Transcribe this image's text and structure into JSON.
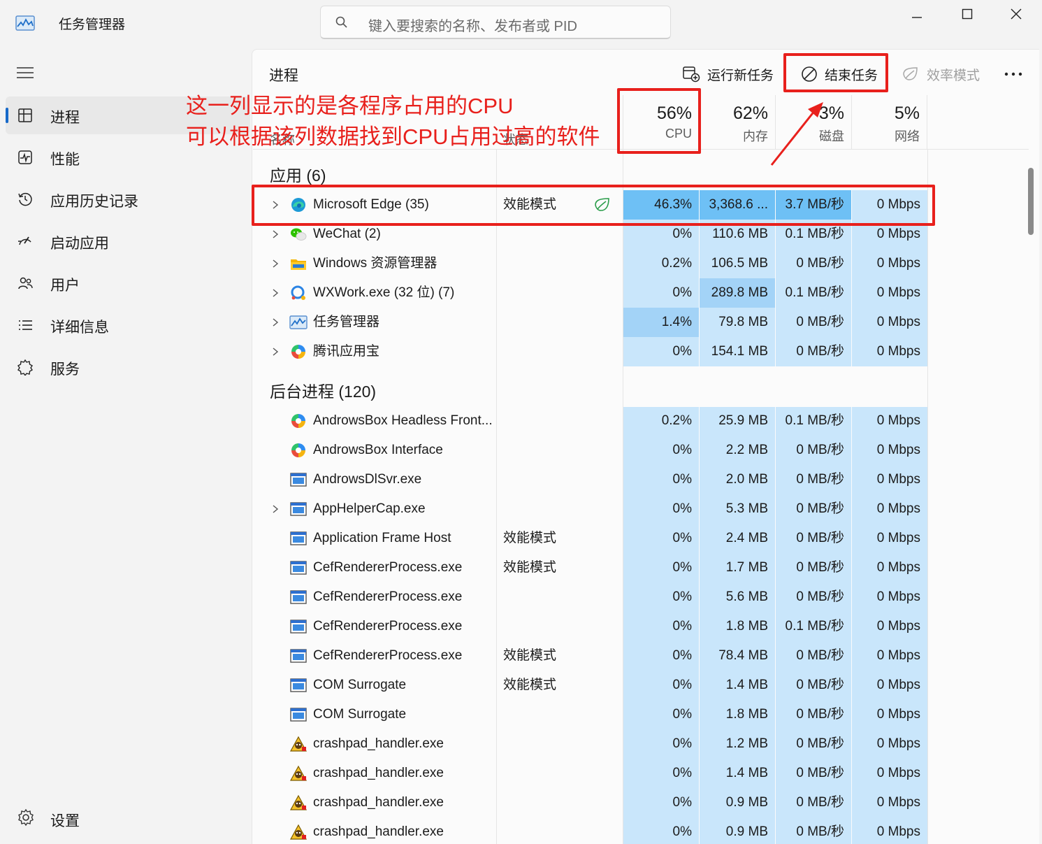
{
  "app": {
    "title": "任务管理器",
    "search_placeholder": "键入要搜索的名称、发布者或 PID"
  },
  "sidebar": {
    "items": [
      {
        "label": "进程",
        "icon": "processes-icon",
        "active": true
      },
      {
        "label": "性能",
        "icon": "performance-icon",
        "active": false
      },
      {
        "label": "应用历史记录",
        "icon": "history-icon",
        "active": false
      },
      {
        "label": "启动应用",
        "icon": "startup-icon",
        "active": false
      },
      {
        "label": "用户",
        "icon": "users-icon",
        "active": false
      },
      {
        "label": "详细信息",
        "icon": "details-icon",
        "active": false
      },
      {
        "label": "服务",
        "icon": "services-icon",
        "active": false
      }
    ],
    "settings_label": "设置"
  },
  "toolbar": {
    "page_title": "进程",
    "run_new_task": "运行新任务",
    "end_task": "结束任务",
    "efficiency_mode": "效率模式"
  },
  "columns": {
    "name": "名称",
    "status": "状态",
    "cpu": {
      "pct": "56%",
      "label": "CPU"
    },
    "memory": {
      "pct": "62%",
      "label": "内存"
    },
    "disk": {
      "pct": "3%",
      "label": "磁盘"
    },
    "network": {
      "pct": "5%",
      "label": "网络"
    }
  },
  "sections": {
    "apps": "应用 (6)",
    "background": "后台进程 (120)"
  },
  "apps": [
    {
      "name": "Microsoft Edge (35)",
      "icon": "edge-icon",
      "expand": true,
      "status": "效能模式",
      "leaf": true,
      "cpu": "46.3%",
      "mem": "3,368.6 ...",
      "disk": "3.7 MB/秒",
      "net": "0 Mbps",
      "cpuHeat": 2,
      "memHeat": 2,
      "diskHeat": 2
    },
    {
      "name": "WeChat (2)",
      "icon": "wechat-icon",
      "expand": true,
      "status": "",
      "leaf": false,
      "cpu": "0%",
      "mem": "110.6 MB",
      "disk": "0.1 MB/秒",
      "net": "0 Mbps",
      "cpuHeat": 0,
      "memHeat": 0,
      "diskHeat": 0
    },
    {
      "name": "Windows 资源管理器",
      "icon": "folder-icon",
      "expand": true,
      "status": "",
      "leaf": false,
      "cpu": "0.2%",
      "mem": "106.5 MB",
      "disk": "0 MB/秒",
      "net": "0 Mbps",
      "cpuHeat": 0,
      "memHeat": 0,
      "diskHeat": 0
    },
    {
      "name": "WXWork.exe (32 位) (7)",
      "icon": "wxwork-icon",
      "expand": true,
      "status": "",
      "leaf": false,
      "cpu": "0%",
      "mem": "289.8 MB",
      "disk": "0.1 MB/秒",
      "net": "0 Mbps",
      "cpuHeat": 0,
      "memHeat": 1,
      "diskHeat": 0
    },
    {
      "name": "任务管理器",
      "icon": "taskmgr-icon",
      "expand": true,
      "status": "",
      "leaf": false,
      "cpu": "1.4%",
      "mem": "79.8 MB",
      "disk": "0 MB/秒",
      "net": "0 Mbps",
      "cpuHeat": 1,
      "memHeat": 0,
      "diskHeat": 0
    },
    {
      "name": "腾讯应用宝",
      "icon": "tencent-icon",
      "expand": true,
      "status": "",
      "leaf": false,
      "cpu": "0%",
      "mem": "154.1 MB",
      "disk": "0 MB/秒",
      "net": "0 Mbps",
      "cpuHeat": 0,
      "memHeat": 0,
      "diskHeat": 0
    }
  ],
  "background": [
    {
      "name": "AndrowsBox Headless Front...",
      "icon": "tencent-icon",
      "expand": false,
      "status": "",
      "cpu": "0.2%",
      "mem": "25.9 MB",
      "disk": "0.1 MB/秒",
      "net": "0 Mbps"
    },
    {
      "name": "AndrowsBox Interface",
      "icon": "tencent-icon",
      "expand": false,
      "status": "",
      "cpu": "0%",
      "mem": "2.2 MB",
      "disk": "0 MB/秒",
      "net": "0 Mbps"
    },
    {
      "name": "AndrowsDlSvr.exe",
      "icon": "window-icon",
      "expand": false,
      "status": "",
      "cpu": "0%",
      "mem": "2.0 MB",
      "disk": "0 MB/秒",
      "net": "0 Mbps"
    },
    {
      "name": "AppHelperCap.exe",
      "icon": "window-icon",
      "expand": true,
      "status": "",
      "cpu": "0%",
      "mem": "5.3 MB",
      "disk": "0 MB/秒",
      "net": "0 Mbps"
    },
    {
      "name": "Application Frame Host",
      "icon": "window-icon",
      "expand": false,
      "status": "效能模式",
      "cpu": "0%",
      "mem": "2.4 MB",
      "disk": "0 MB/秒",
      "net": "0 Mbps"
    },
    {
      "name": "CefRendererProcess.exe",
      "icon": "window-icon",
      "expand": false,
      "status": "效能模式",
      "cpu": "0%",
      "mem": "1.7 MB",
      "disk": "0 MB/秒",
      "net": "0 Mbps"
    },
    {
      "name": "CefRendererProcess.exe",
      "icon": "window-icon",
      "expand": false,
      "status": "",
      "cpu": "0%",
      "mem": "5.6 MB",
      "disk": "0 MB/秒",
      "net": "0 Mbps"
    },
    {
      "name": "CefRendererProcess.exe",
      "icon": "window-icon",
      "expand": false,
      "status": "",
      "cpu": "0%",
      "mem": "1.8 MB",
      "disk": "0.1 MB/秒",
      "net": "0 Mbps"
    },
    {
      "name": "CefRendererProcess.exe",
      "icon": "window-icon",
      "expand": false,
      "status": "效能模式",
      "cpu": "0%",
      "mem": "78.4 MB",
      "disk": "0 MB/秒",
      "net": "0 Mbps"
    },
    {
      "name": "COM Surrogate",
      "icon": "window-icon",
      "expand": false,
      "status": "效能模式",
      "cpu": "0%",
      "mem": "1.4 MB",
      "disk": "0 MB/秒",
      "net": "0 Mbps"
    },
    {
      "name": "COM Surrogate",
      "icon": "window-icon",
      "expand": false,
      "status": "",
      "cpu": "0%",
      "mem": "1.8 MB",
      "disk": "0 MB/秒",
      "net": "0 Mbps"
    },
    {
      "name": "crashpad_handler.exe",
      "icon": "crashpad-icon",
      "expand": false,
      "status": "",
      "cpu": "0%",
      "mem": "1.2 MB",
      "disk": "0 MB/秒",
      "net": "0 Mbps"
    },
    {
      "name": "crashpad_handler.exe",
      "icon": "crashpad-icon",
      "expand": false,
      "status": "",
      "cpu": "0%",
      "mem": "1.4 MB",
      "disk": "0 MB/秒",
      "net": "0 Mbps"
    },
    {
      "name": "crashpad_handler.exe",
      "icon": "crashpad-icon",
      "expand": false,
      "status": "",
      "cpu": "0%",
      "mem": "0.9 MB",
      "disk": "0 MB/秒",
      "net": "0 Mbps"
    },
    {
      "name": "crashpad_handler.exe",
      "icon": "crashpad-icon",
      "expand": false,
      "status": "",
      "cpu": "0%",
      "mem": "0.9 MB",
      "disk": "0 MB/秒",
      "net": "0 Mbps"
    }
  ],
  "annotation": {
    "line1": "这一列显示的是各程序占用的CPU",
    "line2": "可以根据该列数据找到CPU占用过高的软件"
  },
  "colors": {
    "accent": "#1769c9",
    "heat_base": "#c9e6fb",
    "heat_mid": "#a3d3f7",
    "heat_high": "#6ec0f5",
    "annotation_red": "#e8201c"
  }
}
